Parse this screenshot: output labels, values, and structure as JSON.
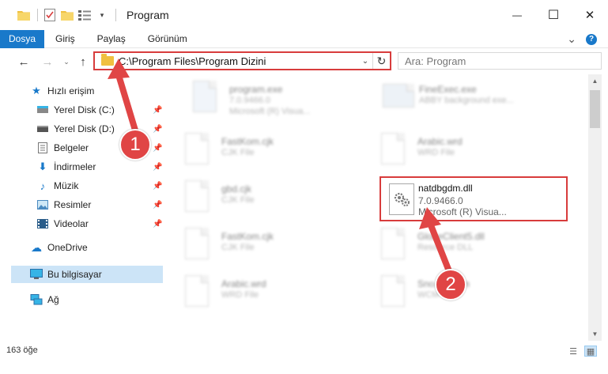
{
  "window": {
    "title": "Program",
    "minimize_glyph": "—",
    "maximize_glyph": "☐",
    "close_glyph": "✕"
  },
  "ribbon": {
    "tabs": [
      {
        "label": "Dosya",
        "active": true
      },
      {
        "label": "Giriş"
      },
      {
        "label": "Paylaş"
      },
      {
        "label": "Görünüm"
      }
    ],
    "collapse_glyph": "⌄",
    "help_glyph": "?"
  },
  "address": {
    "path": "C:\\Program Files\\Program Dizini",
    "search_placeholder": "Ara: Program"
  },
  "nav": {
    "items": [
      {
        "label": "Hızlı erişim",
        "icon": "star-icon"
      },
      {
        "label": "Yerel Disk (C:)",
        "icon": "drive-icon",
        "pinned": true
      },
      {
        "label": "Yerel Disk (D:)",
        "icon": "drive-icon",
        "pinned": true
      },
      {
        "label": "Belgeler",
        "icon": "document-icon",
        "pinned": true
      },
      {
        "label": "İndirmeler",
        "icon": "download-icon",
        "pinned": true
      },
      {
        "label": "Müzik",
        "icon": "music-icon",
        "pinned": true
      },
      {
        "label": "Resimler",
        "icon": "pictures-icon",
        "pinned": true
      },
      {
        "label": "Videolar",
        "icon": "video-icon",
        "pinned": true
      },
      {
        "label": "OneDrive",
        "icon": "cloud-icon"
      },
      {
        "label": "Bu bilgisayar",
        "icon": "computer-icon",
        "selected": true
      },
      {
        "label": "Ağ",
        "icon": "network-icon"
      }
    ]
  },
  "files": [
    {
      "name": "program.exe",
      "type": "7.0.9466.0",
      "desc": "Microsoft (R) Visua..."
    },
    {
      "name": "FineExec.exe",
      "type": "",
      "desc": "ABBY background exe..."
    },
    {
      "name": "FastKom.cjk",
      "type": "CJK File",
      "desc": ""
    },
    {
      "name": "Arabic.wrd",
      "type": "WRD File",
      "desc": ""
    },
    {
      "name": "gbd.cjk",
      "type": "CJK File",
      "desc": ""
    },
    {
      "name": "FastKom.cjk",
      "type": "CJK File",
      "desc": ""
    },
    {
      "name": "GlobeClient5.dll",
      "type": "Resource DLL",
      "desc": ""
    },
    {
      "name": "Arabic.wrd",
      "type": "WRD File",
      "desc": ""
    },
    {
      "name": "Sno...4.wcm",
      "type": "WCM",
      "desc": ""
    }
  ],
  "highlighted_file": {
    "name": "natdbgdm.dll",
    "version": "7.0.9466.0",
    "desc": "Microsoft (R) Visua..."
  },
  "status": {
    "count": "163 öğe"
  },
  "callouts": [
    "1",
    "2"
  ],
  "colors": {
    "accent": "#1979ca",
    "callout": "#e04545",
    "highlight_border": "#d83c3c",
    "selected_bg": "#cce4f7"
  }
}
